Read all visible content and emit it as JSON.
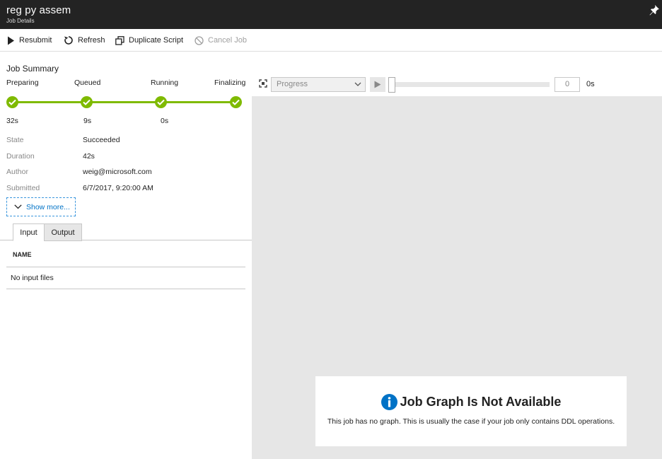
{
  "header": {
    "title": "reg py assem",
    "subtitle": "Job Details"
  },
  "toolbar": {
    "resubmit": "Resubmit",
    "refresh": "Refresh",
    "duplicate": "Duplicate Script",
    "cancel": "Cancel Job"
  },
  "summary": {
    "heading": "Job Summary",
    "stages": [
      {
        "label": "Preparing",
        "duration": "32s"
      },
      {
        "label": "Queued",
        "duration": "9s"
      },
      {
        "label": "Running",
        "duration": "0s"
      },
      {
        "label": "Finalizing",
        "duration": ""
      }
    ],
    "properties": [
      {
        "label": "State",
        "value": "Succeeded"
      },
      {
        "label": "Duration",
        "value": "42s"
      },
      {
        "label": "Author",
        "value": "weig@microsoft.com"
      },
      {
        "label": "Submitted",
        "value": "6/7/2017, 9:20:00 AM"
      }
    ],
    "show_more": "Show more..."
  },
  "tabs": [
    {
      "label": "Input",
      "active": true
    },
    {
      "label": "Output",
      "active": false
    }
  ],
  "files_table": {
    "column": "NAME",
    "empty_text": "No input files"
  },
  "graph_toolbar": {
    "view_select": "Progress",
    "position_value": "0",
    "time_unit": "0s"
  },
  "graph_notice": {
    "title": "Job Graph Is Not Available",
    "body": "This job has no graph. This is usually the case if your job only contains DDL operations."
  },
  "colors": {
    "header_bg": "#232323",
    "success_green": "#7fba00",
    "link_blue": "#0072c6",
    "info_blue": "#0072c6",
    "canvas_gray": "#e6e6e6"
  }
}
